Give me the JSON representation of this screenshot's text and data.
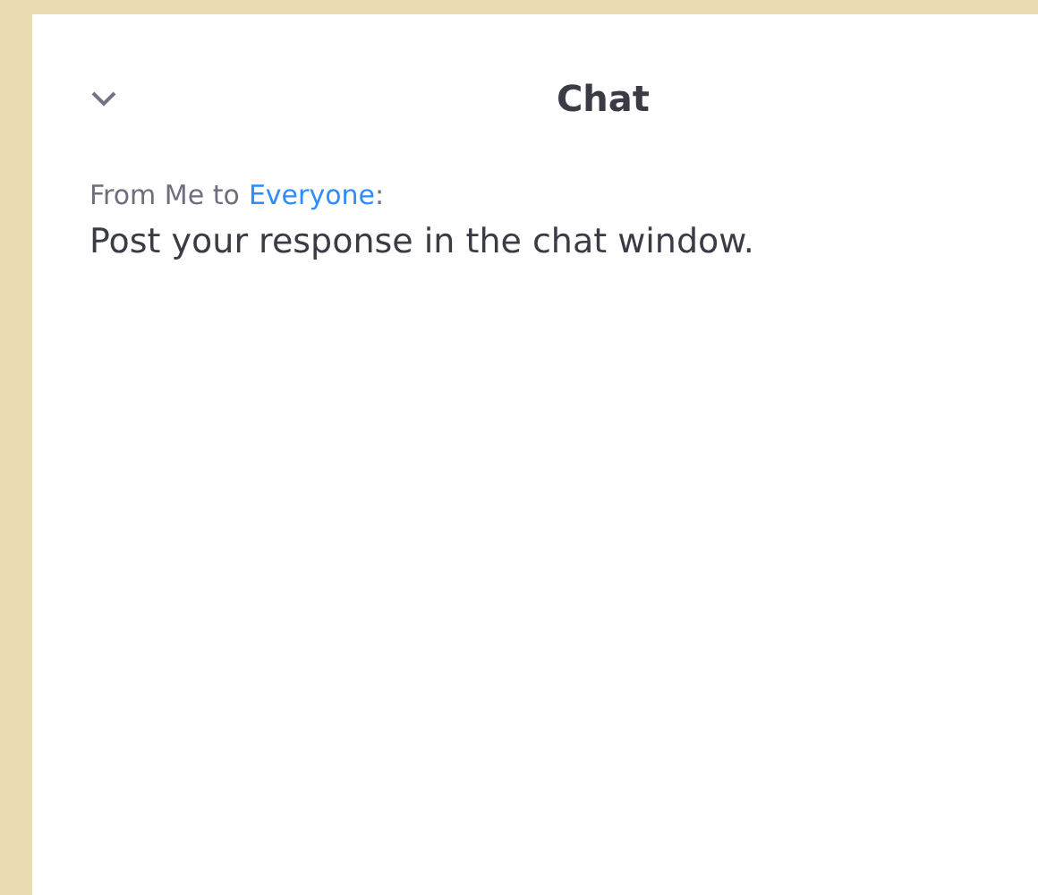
{
  "panel": {
    "title": "Chat",
    "expanded": true
  },
  "messages": [
    {
      "from": "From Me to",
      "recipient": "Everyone",
      "separator": ":",
      "text": "Post your response in the chat window."
    }
  ]
}
